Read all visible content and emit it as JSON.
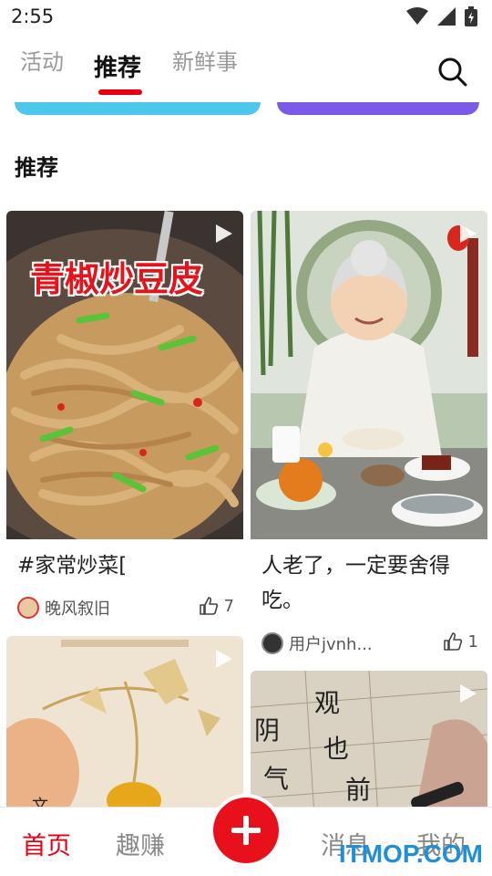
{
  "status": {
    "time": "2:55"
  },
  "tabs": [
    {
      "label": "活动"
    },
    {
      "label": "推荐"
    },
    {
      "label": "新鲜事"
    }
  ],
  "banners": {
    "left_color": "#4ec8ea",
    "right_color": "#7a5ae6"
  },
  "section": {
    "title": "推荐"
  },
  "cards": [
    {
      "overlay_text": "青椒炒豆皮",
      "title": "#家常炒菜[",
      "author": "晚风叙旧",
      "likes": "7"
    },
    {
      "title": "人老了，一定要舍得吃。",
      "author": "用户jvnh...",
      "likes": "1"
    },
    {
      "overlay_text": "文"
    },
    {}
  ],
  "bottom_nav": [
    {
      "label": "首页"
    },
    {
      "label": "趣赚"
    },
    {
      "label": "消息"
    },
    {
      "label": "我的"
    }
  ],
  "accent_color": "#e60012",
  "watermark": "ITMOP.COM"
}
